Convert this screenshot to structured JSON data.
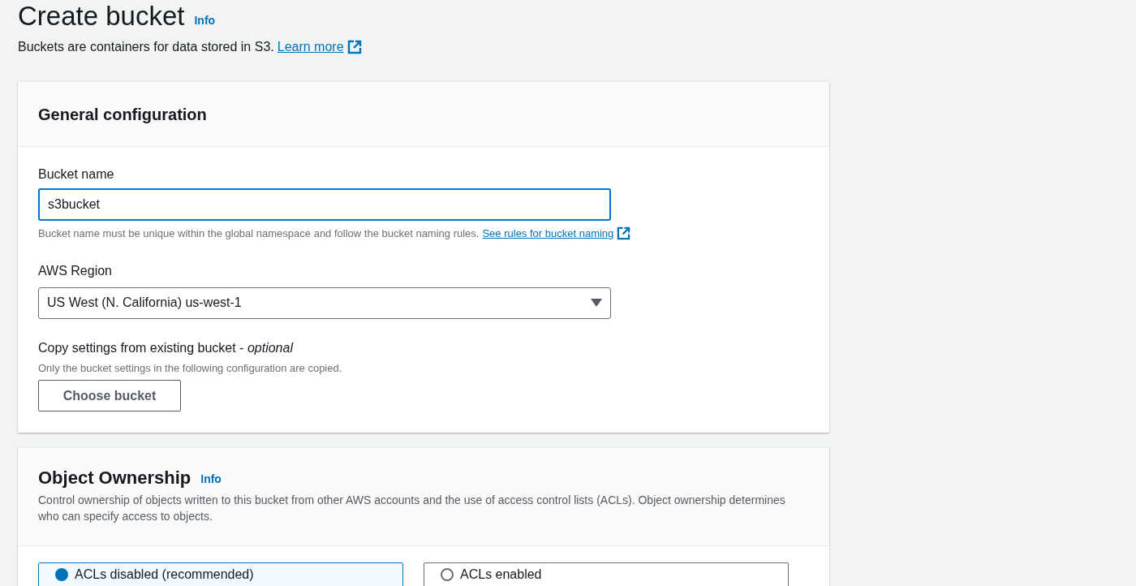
{
  "page": {
    "title": "Create bucket",
    "info_link": "Info",
    "description": "Buckets are containers for data stored in S3.",
    "learn_more_link": "Learn more"
  },
  "general_configuration": {
    "title": "General configuration",
    "bucket_name": {
      "label": "Bucket name",
      "value": "s3bucket",
      "focused": true,
      "hint": "Bucket name must be unique within the global namespace and follow the bucket naming rules.",
      "hint_link": "See rules for bucket naming"
    },
    "aws_region": {
      "label": "AWS Region",
      "value": "US West (N. California) us-west-1"
    },
    "copy_settings": {
      "label": "Copy settings from existing bucket - *optional*",
      "hint": "Only the bucket settings in the following configuration are copied.",
      "button": "Choose bucket"
    }
  },
  "object_ownership": {
    "title": "Object Ownership",
    "info_link": "Info",
    "description": "Control ownership of objects written to this bucket from other AWS accounts and the use of access control lists (ACLs). Object ownership determines who can specify access to objects.",
    "options": [
      {
        "label": "ACLs disabled (recommended)",
        "selected": true
      },
      {
        "label": "ACLs enabled",
        "selected": false
      }
    ]
  }
}
